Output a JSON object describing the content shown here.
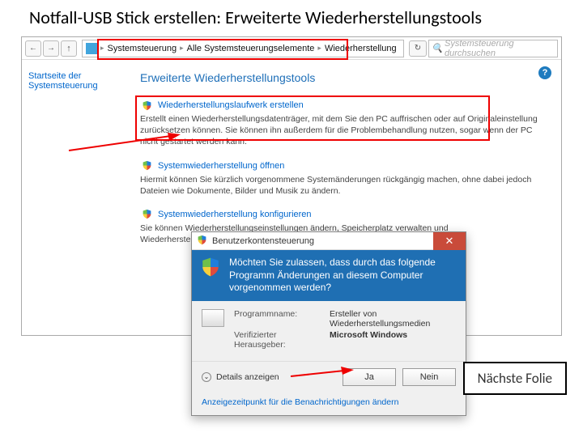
{
  "slide": {
    "title": "Notfall-USB Stick erstellen: Erweiterte Wiederherstellungstools",
    "next_label": "Nächste Folie"
  },
  "toolbar": {
    "breadcrumb": [
      "Systemsteuerung",
      "Alle Systemsteuerungselemente",
      "Wiederherstellung"
    ],
    "search_placeholder": "Systemsteuerung durchsuchen"
  },
  "sidebar": {
    "home_link": "Startseite der Systemsteuerung"
  },
  "main": {
    "heading": "Erweiterte Wiederherstellungstools",
    "options": [
      {
        "title": "Wiederherstellungslaufwerk erstellen",
        "desc": "Erstellt einen Wiederherstellungsdatenträger, mit dem Sie den PC auffrischen oder auf Originaleinstellung zurücksetzen können. Sie können ihn außerdem für die Problembehandlung nutzen, sogar wenn der PC nicht gestartet werden kann."
      },
      {
        "title": "Systemwiederherstellung öffnen",
        "desc": "Hiermit können Sie kürzlich vorgenommene Systemänderungen rückgängig machen, ohne dabei jedoch Dateien wie Dokumente, Bilder und Musik zu ändern."
      },
      {
        "title": "Systemwiederherstellung konfigurieren",
        "desc": "Sie können Wiederherstellungseinstellungen ändern, Speicherplatz verwalten und Wiederherstellungspunkte erstellen oder löschen."
      }
    ]
  },
  "uac": {
    "title": "Benutzerkontensteuerung",
    "question": "Möchten Sie zulassen, dass durch das folgende Programm Änderungen an diesem Computer vorgenommen werden?",
    "program_label": "Programmname:",
    "program_value": "Ersteller von Wiederherstellungsmedien",
    "publisher_label": "Verifizierter Herausgeber:",
    "publisher_value": "Microsoft Windows",
    "details": "Details anzeigen",
    "yes": "Ja",
    "no": "Nein",
    "footer_link": "Anzeigezeitpunkt für die Benachrichtigungen ändern"
  },
  "icons": {
    "back": "←",
    "fwd": "→",
    "up": "↑",
    "refresh": "↻",
    "sep": "▸",
    "close": "✕",
    "chev": "⌄",
    "help": "?",
    "search": "🔍"
  }
}
